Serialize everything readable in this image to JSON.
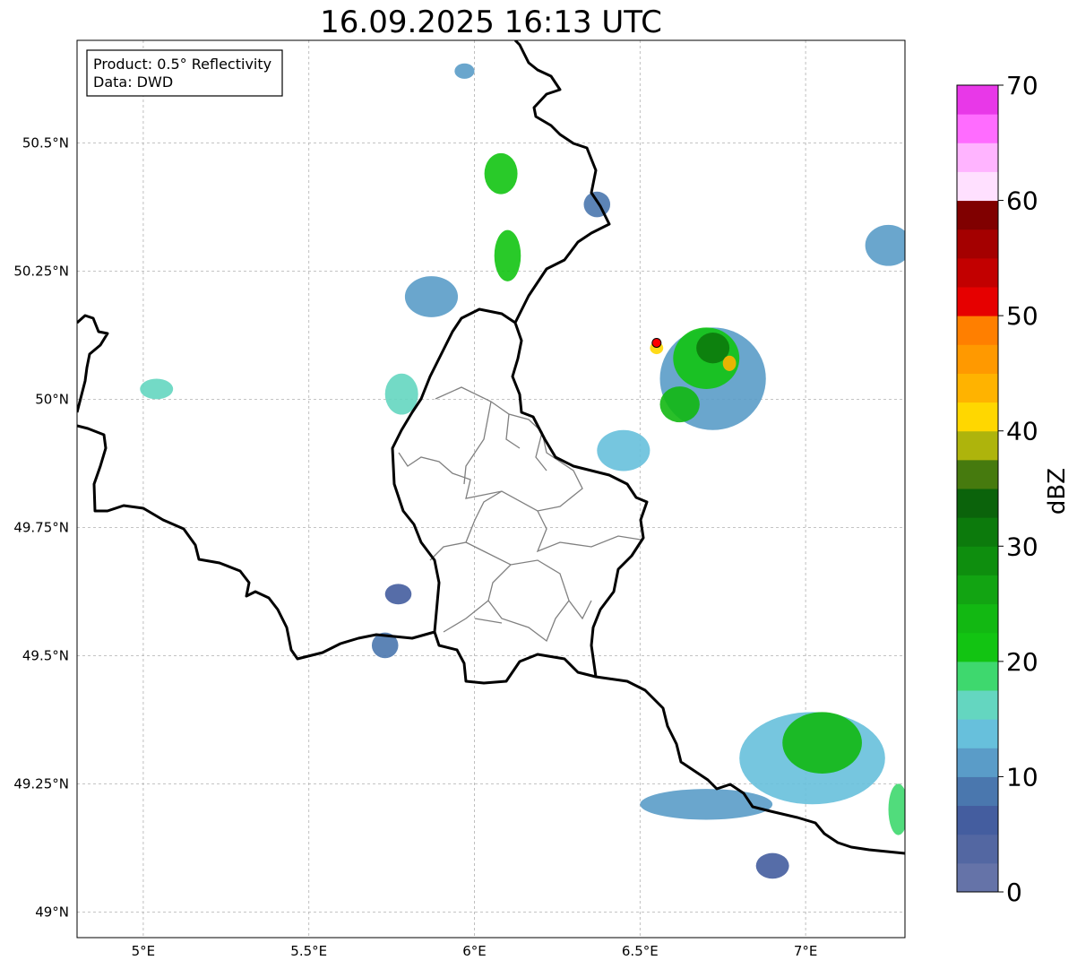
{
  "title": "16.09.2025 16:13 UTC",
  "infobox": {
    "product": "Product: 0.5° Reflectivity",
    "source": "Data: DWD"
  },
  "map": {
    "lon_range": [
      4.8,
      7.3
    ],
    "lat_range": [
      48.95,
      50.7
    ],
    "lon_ticks": [
      {
        "value": 5.0,
        "label": "5°E"
      },
      {
        "value": 5.5,
        "label": "5.5°E"
      },
      {
        "value": 6.0,
        "label": "6°E"
      },
      {
        "value": 6.5,
        "label": "6.5°E"
      },
      {
        "value": 7.0,
        "label": "7°E"
      }
    ],
    "lat_ticks": [
      {
        "value": 50.5,
        "label": "50.5°N"
      },
      {
        "value": 50.25,
        "label": "50.25°N"
      },
      {
        "value": 50.0,
        "label": "50°N"
      },
      {
        "value": 49.75,
        "label": "49.75°N"
      },
      {
        "value": 49.5,
        "label": "49.5°N"
      },
      {
        "value": 49.25,
        "label": "49.25°N"
      },
      {
        "value": 49.0,
        "label": "49°N"
      }
    ],
    "grid": true,
    "radar_site": {
      "lon": 6.55,
      "lat": 50.11,
      "color": "#ff0000"
    }
  },
  "colorbar": {
    "label": "dBZ",
    "range": [
      0,
      70
    ],
    "tick_labels": [
      {
        "value": 0,
        "label": "0"
      },
      {
        "value": 10,
        "label": "10"
      },
      {
        "value": 20,
        "label": "20"
      },
      {
        "value": 30,
        "label": "30"
      },
      {
        "value": 40,
        "label": "40"
      },
      {
        "value": 50,
        "label": "50"
      },
      {
        "value": 60,
        "label": "60"
      },
      {
        "value": 70,
        "label": "70"
      }
    ],
    "colors": [
      "#6573a8",
      "#5367a2",
      "#445d9f",
      "#4a77ae",
      "#5a9cc8",
      "#67c0dc",
      "#64d6c0",
      "#3ed86e",
      "#12c412",
      "#12b812",
      "#12a412",
      "#0e8e0e",
      "#0c7a0c",
      "#0b630b",
      "#467a0e",
      "#aeb40c",
      "#ffd700",
      "#ffb300",
      "#ff9900",
      "#ff7f00",
      "#e60000",
      "#c20000",
      "#a40000",
      "#800000",
      "#ffe0ff",
      "#ffb4ff",
      "#ff6cff",
      "#e838e8"
    ]
  },
  "echoes": [
    {
      "lon": 6.72,
      "lat": 50.04,
      "rx": 0.16,
      "ry": 0.1,
      "dbz": 12
    },
    {
      "lon": 6.7,
      "lat": 50.08,
      "rx": 0.1,
      "ry": 0.06,
      "dbz": 22
    },
    {
      "lon": 6.72,
      "lat": 50.1,
      "rx": 0.05,
      "ry": 0.03,
      "dbz": 30
    },
    {
      "lon": 6.62,
      "lat": 49.99,
      "rx": 0.06,
      "ry": 0.035,
      "dbz": 24
    },
    {
      "lon": 6.45,
      "lat": 49.9,
      "rx": 0.08,
      "ry": 0.04,
      "dbz": 14
    },
    {
      "lon": 6.77,
      "lat": 50.07,
      "rx": 0.02,
      "ry": 0.015,
      "dbz": 44
    },
    {
      "lon": 6.55,
      "lat": 50.1,
      "rx": 0.02,
      "ry": 0.012,
      "dbz": 42
    },
    {
      "lon": 7.02,
      "lat": 49.3,
      "rx": 0.22,
      "ry": 0.09,
      "dbz": 14
    },
    {
      "lon": 7.05,
      "lat": 49.33,
      "rx": 0.12,
      "ry": 0.06,
      "dbz": 24
    },
    {
      "lon": 6.7,
      "lat": 49.21,
      "rx": 0.2,
      "ry": 0.03,
      "dbz": 11
    },
    {
      "lon": 6.9,
      "lat": 49.09,
      "rx": 0.05,
      "ry": 0.025,
      "dbz": 6
    },
    {
      "lon": 7.25,
      "lat": 50.3,
      "rx": 0.07,
      "ry": 0.04,
      "dbz": 10
    },
    {
      "lon": 7.28,
      "lat": 49.2,
      "rx": 0.03,
      "ry": 0.05,
      "dbz": 18
    },
    {
      "lon": 5.87,
      "lat": 50.2,
      "rx": 0.08,
      "ry": 0.04,
      "dbz": 10
    },
    {
      "lon": 6.1,
      "lat": 50.28,
      "rx": 0.04,
      "ry": 0.05,
      "dbz": 20
    },
    {
      "lon": 6.08,
      "lat": 50.44,
      "rx": 0.05,
      "ry": 0.04,
      "dbz": 22
    },
    {
      "lon": 5.78,
      "lat": 50.01,
      "rx": 0.05,
      "ry": 0.04,
      "dbz": 16
    },
    {
      "lon": 5.04,
      "lat": 50.02,
      "rx": 0.05,
      "ry": 0.02,
      "dbz": 16
    },
    {
      "lon": 5.73,
      "lat": 49.52,
      "rx": 0.04,
      "ry": 0.025,
      "dbz": 9
    },
    {
      "lon": 5.77,
      "lat": 49.62,
      "rx": 0.04,
      "ry": 0.02,
      "dbz": 7
    },
    {
      "lon": 5.97,
      "lat": 50.64,
      "rx": 0.03,
      "ry": 0.015,
      "dbz": 10
    },
    {
      "lon": 6.37,
      "lat": 50.38,
      "rx": 0.04,
      "ry": 0.025,
      "dbz": 9
    }
  ]
}
